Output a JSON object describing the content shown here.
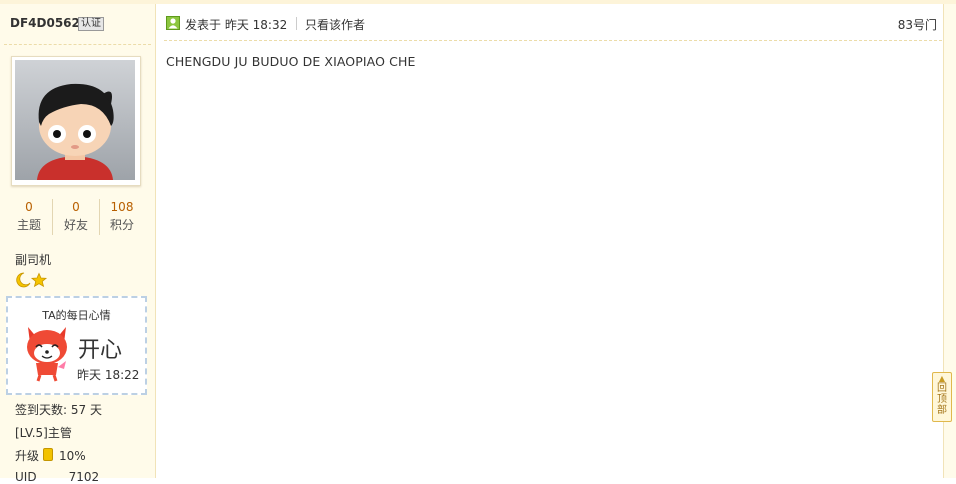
{
  "sidebar": {
    "username": "DF4D0562",
    "verify_badge": "认证",
    "stats": [
      {
        "value": "0",
        "label": "主题"
      },
      {
        "value": "0",
        "label": "好友"
      },
      {
        "value": "108",
        "label": "积分"
      }
    ],
    "rank": "副司机",
    "mood": {
      "title": "TA的每日心情",
      "word": "开心",
      "time": "昨天 18:22"
    },
    "checkin": "签到天数: 57 天",
    "level": "[LV.5]主管",
    "upgrade_label": "升级",
    "upgrade_percent": "10%",
    "uid_label": "UID",
    "uid_value": "7102"
  },
  "post": {
    "posted_at": "发表于 昨天 18:32",
    "only_author": "只看该作者",
    "floor": "83号门",
    "content": "CHENGDU JU BUDUO DE XIAOPIAO CHE"
  },
  "back_to_top": {
    "arrow": "▲",
    "label": "回顶部"
  },
  "colors": {
    "sidebar_bg": "#fffbea",
    "stat_number": "#b85f00",
    "accent_border": "#ecdca9"
  }
}
